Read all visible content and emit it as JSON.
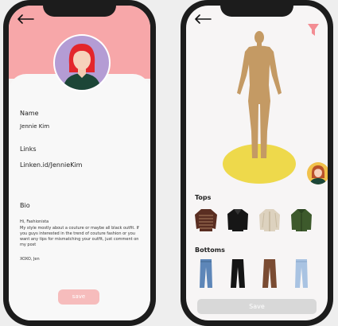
{
  "profile": {
    "name_label": "Name",
    "name_value": "Jennie Kim",
    "links_label": "Links",
    "links_value": "Linken.id/JennieKim",
    "bio_label": "Bio",
    "bio_greeting": "Hi, Fashionista",
    "bio_body": "My style mostly about a couture or maybe all black outfit. If you guys interested in the trend of couture fashion or you want any tips for mismatching your outfit, just comment on my post",
    "bio_signoff": "XOXO, Jen",
    "save_label": "save"
  },
  "closet": {
    "tops_label": "Tops",
    "bottoms_label": "Bottoms",
    "save_label": "Save",
    "tops": [
      "striped-sweater-icon",
      "black-jacket-icon",
      "beige-cardigan-icon",
      "green-jacket-icon"
    ],
    "bottoms": [
      "blue-jeans-icon",
      "black-trousers-icon",
      "brown-trousers-icon",
      "light-jeans-icon"
    ]
  },
  "colors": {
    "header_pink": "#f7a7a9",
    "save_pink": "#f6bcbc",
    "filter_pink": "#f38d93",
    "mannequin": "#c49a64",
    "spotlight_yellow": "#eed94b",
    "save_gray": "#d8d8d8"
  }
}
